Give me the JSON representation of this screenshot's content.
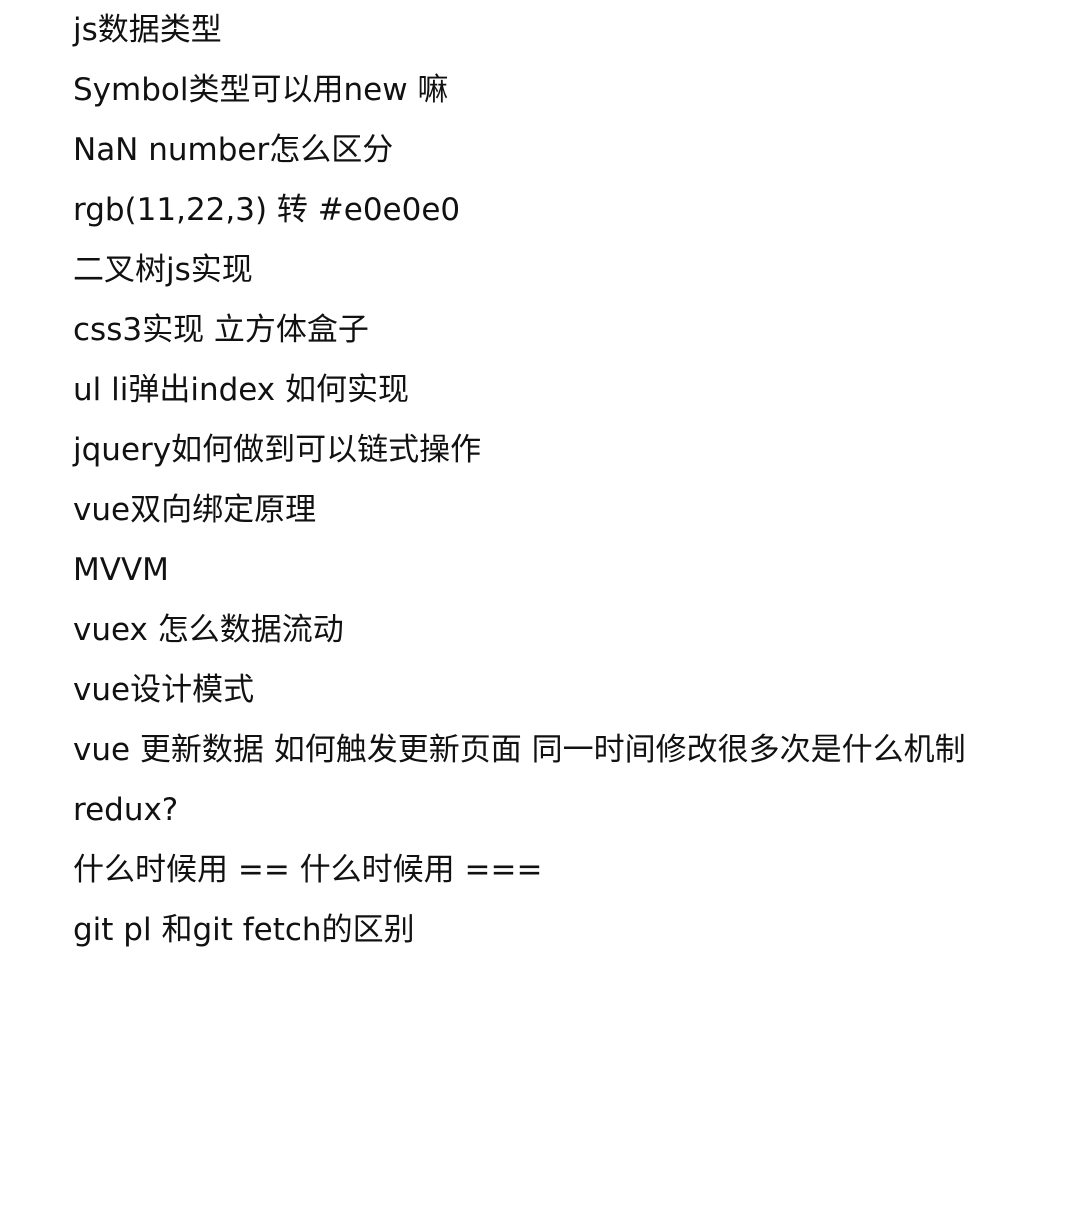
{
  "note": {
    "lines": [
      "js数据类型",
      "Symbol类型可以用new 嘛",
      "NaN number怎么区分",
      "rgb(11,22,3) 转 #e0e0e0",
      "二叉树js实现",
      "css3实现 立方体盒子",
      "ul li弹出index 如何实现",
      "jquery如何做到可以链式操作",
      "vue双向绑定原理",
      "MVVM",
      "vuex 怎么数据流动",
      "vue设计模式",
      "vue 更新数据 如何触发更新页面 同一时间修改很多次是什么机制",
      "redux?",
      "什么时候用 == 什么时候用 ===",
      "git pl 和git fetch的区别"
    ]
  }
}
